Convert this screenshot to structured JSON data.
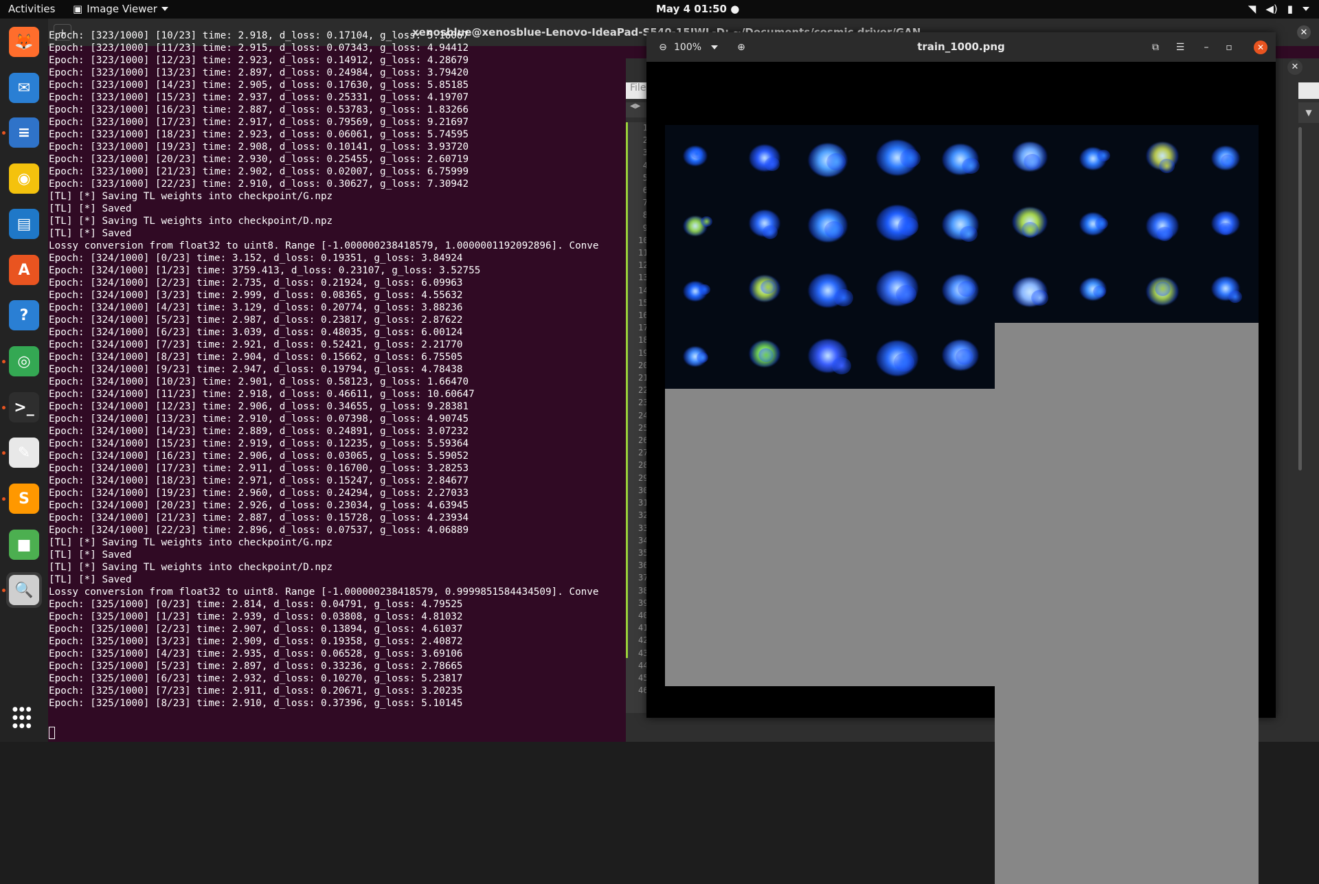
{
  "topbar": {
    "activities": "Activities",
    "app_menu": "Image Viewer",
    "clock": "May 4  01:50"
  },
  "dock": {
    "items": [
      {
        "name": "firefox-icon",
        "color": "#ff6d2c",
        "glyph": "🦊",
        "running": false
      },
      {
        "name": "thunderbird-icon",
        "color": "#2a7fd4",
        "glyph": "✉",
        "running": false
      },
      {
        "name": "notes-icon",
        "color": "#2f73c9",
        "glyph": "≡",
        "running": true
      },
      {
        "name": "rhythmbox-icon",
        "color": "#f4c20d",
        "glyph": "◉",
        "running": false
      },
      {
        "name": "writer-icon",
        "color": "#1f78c8",
        "glyph": "▤",
        "running": false
      },
      {
        "name": "software-center-icon",
        "color": "#e95420",
        "glyph": "A",
        "running": false
      },
      {
        "name": "help-icon",
        "color": "#2a7fd4",
        "glyph": "?",
        "running": false
      },
      {
        "name": "chrome-icon",
        "color": "#34a853",
        "glyph": "◎",
        "running": true
      },
      {
        "name": "terminal-icon",
        "color": "#2e2e2e",
        "glyph": ">_",
        "running": true
      },
      {
        "name": "text-editor-icon",
        "color": "#e8e8e8",
        "glyph": "✎",
        "running": true
      },
      {
        "name": "sublime-icon",
        "color": "#ff9800",
        "glyph": "S",
        "running": true
      },
      {
        "name": "colors-app-icon",
        "color": "#4caf50",
        "glyph": "■",
        "running": false
      },
      {
        "name": "image-viewer-icon",
        "color": "#cfcfcf",
        "glyph": "🔍",
        "running": true
      }
    ],
    "apps_grid": "⋮⋮⋮"
  },
  "terminal": {
    "title": "xenosblue@xenosblue-Lenovo-IdeaPad-S540-15IWL-D: ~/Documents/cosmic driver/GAN",
    "lines": [
      "Epoch: [323/1000] [10/23] time: 2.918, d_loss: 0.17104, g_loss: 5.16067",
      "Epoch: [323/1000] [11/23] time: 2.915, d_loss: 0.07343, g_loss: 4.94412",
      "Epoch: [323/1000] [12/23] time: 2.923, d_loss: 0.14912, g_loss: 4.28679",
      "Epoch: [323/1000] [13/23] time: 2.897, d_loss: 0.24984, g_loss: 3.79420",
      "Epoch: [323/1000] [14/23] time: 2.905, d_loss: 0.17630, g_loss: 5.85185",
      "Epoch: [323/1000] [15/23] time: 2.937, d_loss: 0.25331, g_loss: 4.19707",
      "Epoch: [323/1000] [16/23] time: 2.887, d_loss: 0.53783, g_loss: 1.83266",
      "Epoch: [323/1000] [17/23] time: 2.917, d_loss: 0.79569, g_loss: 9.21697",
      "Epoch: [323/1000] [18/23] time: 2.923, d_loss: 0.06061, g_loss: 5.74595",
      "Epoch: [323/1000] [19/23] time: 2.908, d_loss: 0.10141, g_loss: 3.93720",
      "Epoch: [323/1000] [20/23] time: 2.930, d_loss: 0.25455, g_loss: 2.60719",
      "Epoch: [323/1000] [21/23] time: 2.902, d_loss: 0.02007, g_loss: 6.75999",
      "Epoch: [323/1000] [22/23] time: 2.910, d_loss: 0.30627, g_loss: 7.30942",
      "[TL] [*] Saving TL weights into checkpoint/G.npz",
      "[TL] [*] Saved",
      "[TL] [*] Saving TL weights into checkpoint/D.npz",
      "[TL] [*] Saved",
      "Lossy conversion from float32 to uint8. Range [-1.000000238418579, 1.0000001192092896]. Conve",
      "Epoch: [324/1000] [0/23] time: 3.152, d_loss: 0.19351, g_loss: 3.84924",
      "Epoch: [324/1000] [1/23] time: 3759.413, d_loss: 0.23107, g_loss: 3.52755",
      "Epoch: [324/1000] [2/23] time: 2.735, d_loss: 0.21924, g_loss: 6.09963",
      "Epoch: [324/1000] [3/23] time: 2.999, d_loss: 0.08365, g_loss: 4.55632",
      "Epoch: [324/1000] [4/23] time: 3.129, d_loss: 0.20774, g_loss: 3.88236",
      "Epoch: [324/1000] [5/23] time: 2.987, d_loss: 0.23817, g_loss: 2.87622",
      "Epoch: [324/1000] [6/23] time: 3.039, d_loss: 0.48035, g_loss: 6.00124",
      "Epoch: [324/1000] [7/23] time: 2.921, d_loss: 0.52421, g_loss: 2.21770",
      "Epoch: [324/1000] [8/23] time: 2.904, d_loss: 0.15662, g_loss: 6.75505",
      "Epoch: [324/1000] [9/23] time: 2.947, d_loss: 0.19794, g_loss: 4.78438",
      "Epoch: [324/1000] [10/23] time: 2.901, d_loss: 0.58123, g_loss: 1.66470",
      "Epoch: [324/1000] [11/23] time: 2.918, d_loss: 0.46611, g_loss: 10.60647",
      "Epoch: [324/1000] [12/23] time: 2.906, d_loss: 0.34655, g_loss: 9.28381",
      "Epoch: [324/1000] [13/23] time: 2.910, d_loss: 0.07398, g_loss: 4.90745",
      "Epoch: [324/1000] [14/23] time: 2.889, d_loss: 0.24891, g_loss: 3.07232",
      "Epoch: [324/1000] [15/23] time: 2.919, d_loss: 0.12235, g_loss: 5.59364",
      "Epoch: [324/1000] [16/23] time: 2.906, d_loss: 0.03065, g_loss: 5.59052",
      "Epoch: [324/1000] [17/23] time: 2.911, d_loss: 0.16700, g_loss: 3.28253",
      "Epoch: [324/1000] [18/23] time: 2.971, d_loss: 0.15247, g_loss: 2.84677",
      "Epoch: [324/1000] [19/23] time: 2.960, d_loss: 0.24294, g_loss: 2.27033",
      "Epoch: [324/1000] [20/23] time: 2.926, d_loss: 0.23034, g_loss: 4.63945",
      "Epoch: [324/1000] [21/23] time: 2.887, d_loss: 0.15728, g_loss: 4.23934",
      "Epoch: [324/1000] [22/23] time: 2.896, d_loss: 0.07537, g_loss: 4.06889",
      "[TL] [*] Saving TL weights into checkpoint/G.npz",
      "[TL] [*] Saved",
      "[TL] [*] Saving TL weights into checkpoint/D.npz",
      "[TL] [*] Saved",
      "Lossy conversion from float32 to uint8. Range [-1.000000238418579, 0.9999851584434509]. Conve",
      "Epoch: [325/1000] [0/23] time: 2.814, d_loss: 0.04791, g_loss: 4.79525",
      "Epoch: [325/1000] [1/23] time: 2.939, d_loss: 0.03808, g_loss: 4.81032",
      "Epoch: [325/1000] [2/23] time: 2.907, d_loss: 0.13894, g_loss: 4.61037",
      "Epoch: [325/1000] [3/23] time: 2.909, d_loss: 0.19358, g_loss: 2.40872",
      "Epoch: [325/1000] [4/23] time: 2.935, d_loss: 0.06528, g_loss: 3.69106",
      "Epoch: [325/1000] [5/23] time: 2.897, d_loss: 0.33236, g_loss: 2.78665",
      "Epoch: [325/1000] [6/23] time: 2.932, d_loss: 0.10270, g_loss: 5.23817",
      "Epoch: [325/1000] [7/23] time: 2.911, d_loss: 0.20671, g_loss: 3.20235",
      "Epoch: [325/1000] [8/23] time: 2.910, d_loss: 0.37396, g_loss: 5.10145"
    ]
  },
  "gedit": {
    "file_tab": "File",
    "line_numbers": [
      "1",
      "2",
      "3",
      "4",
      "5",
      "6",
      "7",
      "8",
      "9",
      "10",
      "11",
      "12",
      "13",
      "14",
      "15",
      "16",
      "17",
      "18",
      "19",
      "20",
      "21",
      "22",
      "23",
      "24",
      "25",
      "26",
      "27",
      "28",
      "29",
      "30",
      "31",
      "32",
      "33",
      "34",
      "35",
      "36",
      "37",
      "38",
      "39",
      "40",
      "41",
      "42",
      "43",
      "44",
      "45",
      "46"
    ]
  },
  "viewer": {
    "zoom": "100%",
    "title": "train_1000.png",
    "grid": {
      "filled_tiles": 32,
      "tile_colors": [
        "#1e6bff",
        "#2a5cff",
        "#4ea0ff",
        "#2d7bff",
        "#3f8fff",
        "#6aa7ff",
        "#2e7dff",
        "#b8c84a",
        "#3b86ff",
        "#8fd14f",
        "#2f6eff",
        "#3a8bff",
        "#1f5fff",
        "#4b9aff",
        "#a8d84a",
        "#2a7cff",
        "#3270ff",
        "#2b66ff",
        "#1e66ff",
        "#a6d246",
        "#2b6cff",
        "#3c76ff",
        "#4f90ff",
        "#8ab7ff",
        "#3f92ff",
        "#a0c94c",
        "#2f77ff",
        "#3f8bff",
        "#6fd04e",
        "#3b5fff",
        "#2c6fff",
        "#4987ff"
      ]
    }
  }
}
